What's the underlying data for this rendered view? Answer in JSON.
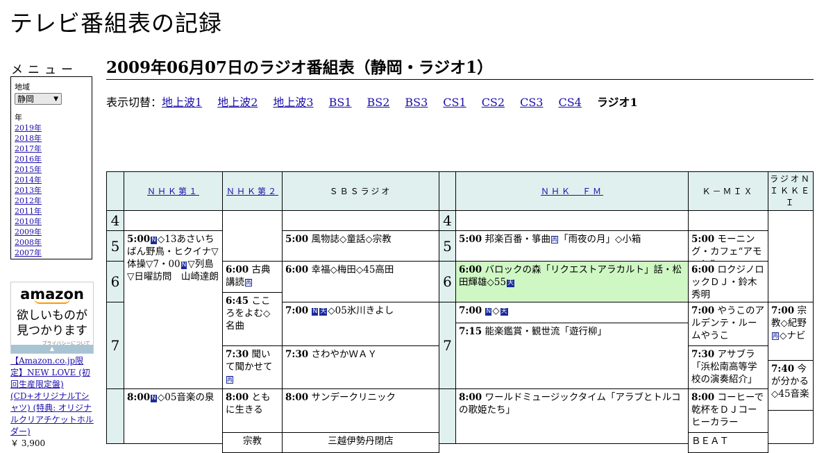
{
  "site": {
    "title": "テレビ番組表の記録"
  },
  "menu": {
    "heading": "メニュー",
    "region_label": "地域",
    "region_value": "静岡",
    "year_label": "年",
    "years": [
      "2019年",
      "2018年",
      "2017年",
      "2016年",
      "2015年",
      "2014年",
      "2013年",
      "2012年",
      "2011年",
      "2010年",
      "2009年",
      "2008年",
      "2007年"
    ]
  },
  "ad": {
    "logo": "amazon",
    "message_line1": "欲しいものが",
    "message_line2": "見つかります",
    "privacy": "プライバシーについて",
    "bar_icon": "▲"
  },
  "product": {
    "title": "【Amazon.co.jp限定】NEW LOVE (初回生産限定盤) (CD+オリジナルTシャツ) (特典: オリジナルクリアチケットホルダー)",
    "price": "￥ 3,900"
  },
  "page": {
    "title": "2009年06月07日のラジオ番組表（静岡・ラジオ1）"
  },
  "switcher": {
    "label": "表示切替：",
    "links": [
      "地上波1",
      "地上波2",
      "地上波3",
      "BS1",
      "BS2",
      "BS3",
      "CS1",
      "CS2",
      "CS3",
      "CS4"
    ],
    "current": "ラジオ1"
  },
  "channels": [
    "ＮＨＫ第１",
    "ＮＨＫ第２",
    "ＳＢＳラジオ",
    "ＮＨＫ　ＦＭ",
    "Ｋ－ＭＩＸ",
    "ラジオＮＩＫＫＥＩ"
  ],
  "hours": [
    "4",
    "5",
    "6",
    "7",
    "4",
    "5",
    "6",
    "7"
  ],
  "programs": {
    "nhk1_500": {
      "time": "5:00",
      "text": "◇13あさいちばん野鳥・ヒクイナ▽体操▽7・00",
      "text2": "▽列島▽日曜訪問　山崎達朗"
    },
    "nhk1_800": {
      "time": "8:00",
      "text": "◇05音楽の泉"
    },
    "nhk2_600": {
      "time": "6:00",
      "text": "古典講読"
    },
    "nhk2_645": {
      "time": "6:45",
      "text": "こころをよむ◇名曲"
    },
    "nhk2_730": {
      "time": "7:30",
      "text": "聞いて聞かせて"
    },
    "nhk2_800": {
      "time": "8:00",
      "text": "ともに生きる"
    },
    "nhk2_next": {
      "text": "宗教"
    },
    "sbs_500": {
      "time": "5:00",
      "text": "風物誌◇童話◇宗教"
    },
    "sbs_600": {
      "time": "6:00",
      "text": "幸福◇梅田◇45高田"
    },
    "sbs_700": {
      "time": "7:00",
      "text": "◇05氷川きよし"
    },
    "sbs_730": {
      "time": "7:30",
      "text": "さわやかＷＡＹ"
    },
    "sbs_800": {
      "time": "8:00",
      "text": "サンデークリニック"
    },
    "sbs_next": {
      "text": "三越伊勢丹閉店"
    },
    "fm_500": {
      "time": "5:00",
      "text": "邦楽百番・箏曲",
      "text2": "「雨夜の月」◇小箱"
    },
    "fm_600": {
      "time": "6:00",
      "text": "バロックの森「リクエストアラカルト」話・松田輝雄◇55"
    },
    "fm_700": {
      "time": "7:00",
      "text": "◇"
    },
    "fm_715": {
      "time": "7:15",
      "text": "能楽鑑賞・観世流「遊行柳」"
    },
    "fm_800": {
      "time": "8:00",
      "text": "ワールドミュージックタイム「アラブとトルコの歌姫たち」"
    },
    "kmix_500": {
      "time": "5:00",
      "text": "モーニング・カフェ“アモーレ”"
    },
    "kmix_600": {
      "time": "6:00",
      "text": "ロクジノロックＤＪ・鈴木秀明"
    },
    "kmix_700": {
      "time": "7:00",
      "text": "やうこのアルデンテ・ルームやうこ"
    },
    "kmix_730": {
      "time": "7:30",
      "text": "アサブラ「浜松南高等学校の演奏紹介」"
    },
    "kmix_800": {
      "time": "8:00",
      "text": "コーヒーで乾杯をＤＪコーヒーカラー"
    },
    "kmix_next": {
      "text": "ＢＥＡＴ"
    },
    "nikkei_700": {
      "time": "7:00",
      "text": "宗教◇紀野",
      "text2": "◇ナビ"
    },
    "nikkei_740": {
      "time": "7:40",
      "text": "今が分かる◇45音楽"
    }
  },
  "icons": {
    "news": "N",
    "stereo": "天",
    "rebroadcast": "再"
  }
}
